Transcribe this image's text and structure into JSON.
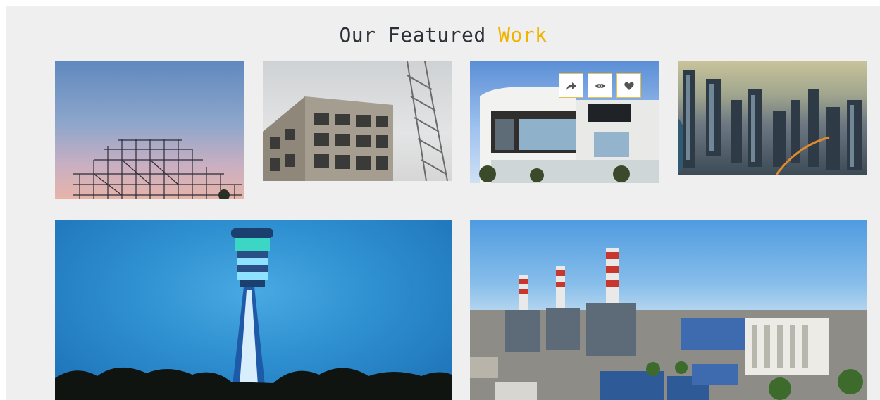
{
  "section": {
    "title_main": "Our Featured",
    "title_accent": "Work"
  },
  "colors": {
    "accent": "#f0b400",
    "title_text": "#2b2f36",
    "section_bg": "#efefef"
  },
  "portfolio": {
    "items": [
      {
        "subject": "scaffolding structure at dusk"
      },
      {
        "subject": "concrete building under construction with crane"
      },
      {
        "subject": "modern residential house",
        "actions": [
          "share-icon",
          "eye-icon",
          "heart-icon"
        ]
      },
      {
        "subject": "aerial city skyline"
      },
      {
        "subject": "airport control tower at night"
      },
      {
        "subject": "power plant with striped chimneys"
      }
    ]
  }
}
